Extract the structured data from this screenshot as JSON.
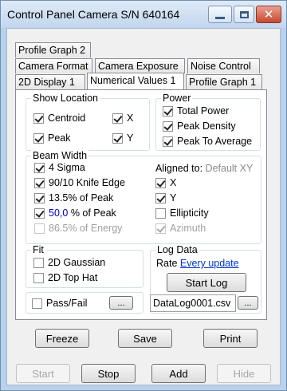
{
  "window": {
    "title": "Control Panel Camera S/N 640164",
    "close_glyph": "✕"
  },
  "tabs": {
    "row1": [
      "Profile Graph 2"
    ],
    "row2": [
      "Camera Format",
      "Camera Exposure",
      "Noise Control"
    ],
    "row3": [
      "2D Display 1",
      "Numerical Values 1",
      "Profile Graph 1"
    ],
    "active": "Numerical Values 1"
  },
  "show_location": {
    "title": "Show Location",
    "centroid": "Centroid",
    "x": "X",
    "peak": "Peak",
    "y": "Y"
  },
  "power": {
    "title": "Power",
    "total_power": "Total Power",
    "peak_density": "Peak Density",
    "peak_to_average": "Peak To Average"
  },
  "beam_width": {
    "title": "Beam Width",
    "sigma": "4 Sigma",
    "knife_edge": "90/10 Knife Edge",
    "pct_peak_135": "13.5% of Peak",
    "custom_value": "50,0",
    "custom_suffix": " % of Peak",
    "energy": "86.5% of Energy",
    "aligned_label": "Aligned to:",
    "aligned_value": " Default XY",
    "x": "X",
    "y": "Y",
    "ellipticity": "Ellipticity",
    "azimuth": "Azimuth"
  },
  "fit": {
    "title": "Fit",
    "gaussian": "2D Gaussian",
    "top_hat": "2D Top Hat"
  },
  "log_data": {
    "title": "Log Data",
    "rate_label": "Rate ",
    "rate_value": "Every update",
    "start_log": "Start Log",
    "file_name": "DataLog0001.csv",
    "browse": "..."
  },
  "pass_fail": {
    "label": "Pass/Fail",
    "browse": "..."
  },
  "panel_buttons": {
    "freeze": "Freeze",
    "save": "Save",
    "print": "Print"
  },
  "bottom_buttons": {
    "start": "Start",
    "stop": "Stop",
    "add": "Add",
    "hide": "Hide"
  },
  "colors": {
    "window_border": "#b9d1ea",
    "custom_value": "#0000c8",
    "link": "#0033cc",
    "disabled_text": "#a0a0a0"
  }
}
